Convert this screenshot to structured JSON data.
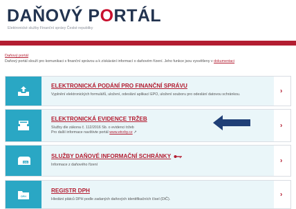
{
  "header": {
    "logo_part1": "DAŇOVÝ P",
    "logo_part2": "O",
    "logo_part3": "RTÁL",
    "subtitle": "Elektronické služby Finanční správy České republiky"
  },
  "breadcrumb": "Daňový portál",
  "intro": {
    "text": "Daňový portál slouží pro komunikaci s finanční správou a k získávání informací o daňovém řízení. Jeho funkce jsou vysvětleny v",
    "link": "dokumentaci"
  },
  "cards": [
    {
      "title": "ELEKTRONICKÁ PODÁNÍ PRO FINANČNÍ SPRÁVU",
      "desc": "Vyplnění elektronických formulářů, uložení, odeslání aplikací EPO, uložení souboru pro odeslání datovou schránkou.",
      "icon": "inbox-upload-icon"
    },
    {
      "title": "ELEKTRONICKÁ EVIDENCE TRŽEB",
      "desc1": "Služby dle zákona č. 112/2016 Sb. o evidenci tržeb",
      "desc2": "Pro další informace navštivte portál",
      "link": "www.etrzby.cz",
      "icon": "cash-register-icon"
    },
    {
      "title": "SLUŽBY DAŇOVÉ INFORMAČNÍ SCHRÁNKY",
      "desc": "Informace z daňového řízení",
      "icon": "mailbox-icon",
      "icon_label": "DIS"
    },
    {
      "title": "REGISTR DPH",
      "desc": "Hledání plátců DPH podle zadaných daňových identifikačních čísel (DIČ).",
      "icon": "register-folder-icon",
      "icon_label": "DPH"
    }
  ],
  "arrow_glyph": "›",
  "colors": {
    "brand_red": "#b31d31",
    "tile_blue": "#2aa7c4",
    "card_bg": "#eaf6f9",
    "annotation_arrow": "#1f3f77"
  }
}
